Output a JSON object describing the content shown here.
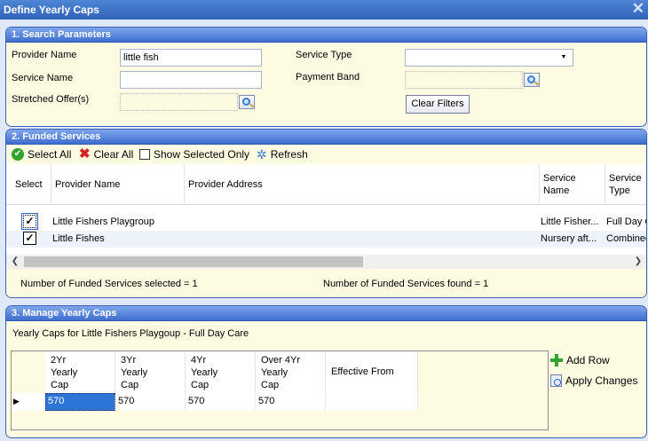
{
  "window": {
    "title": "Define Yearly Caps",
    "close_glyph": "✕"
  },
  "search": {
    "header": "1. Search Parameters",
    "provider_name_label": "Provider Name",
    "provider_name_value": "little fish",
    "service_name_label": "Service Name",
    "service_name_value": "",
    "stretched_offer_label": "Stretched Offer(s)",
    "service_type_label": "Service Type",
    "service_type_value": "",
    "payment_band_label": "Payment Band",
    "clear_filters": "Clear Filters"
  },
  "funded": {
    "header": "2. Funded Services",
    "toolbar": {
      "select_all": "Select All",
      "clear_all": "Clear All",
      "show_selected_only": "Show Selected Only",
      "refresh": "Refresh"
    },
    "columns": [
      "Select",
      "Provider Name",
      "Provider Address",
      "Service\nName",
      "Service\nType"
    ],
    "rows": [
      {
        "checked": true,
        "provider": "Little Fishers Playgroup",
        "address": "",
        "service_name": "Little Fisher...",
        "service_type": "Full Day C"
      },
      {
        "checked": true,
        "provider": "Little Fishes",
        "address": "",
        "service_name": "Nursery aft...",
        "service_type": "Combined"
      }
    ],
    "selected_text": "Number of Funded Services selected = 1",
    "found_text": "Number of Funded Services found = 1"
  },
  "caps": {
    "header": "3. Manage Yearly Caps",
    "subtitle": "Yearly Caps for Little Fishers Playgoup - Full Day Care",
    "columns": [
      "2Yr\nYearly\nCap",
      "3Yr\nYearly\nCap",
      "4Yr\nYearly\nCap",
      "Over 4Yr\nYearly\nCap",
      "Effective From"
    ],
    "row": {
      "c2yr": "570",
      "c3yr": "570",
      "c4yr": "570",
      "over4yr": "570",
      "effective_from": ""
    },
    "add_row": "Add Row",
    "apply_changes": "Apply Changes"
  },
  "colors": {
    "header_gradient_top": "#7fa6ec",
    "header_gradient_bottom": "#3e6ed0",
    "panel_bg": "#fdfce2",
    "selection": "#2d74d6"
  }
}
